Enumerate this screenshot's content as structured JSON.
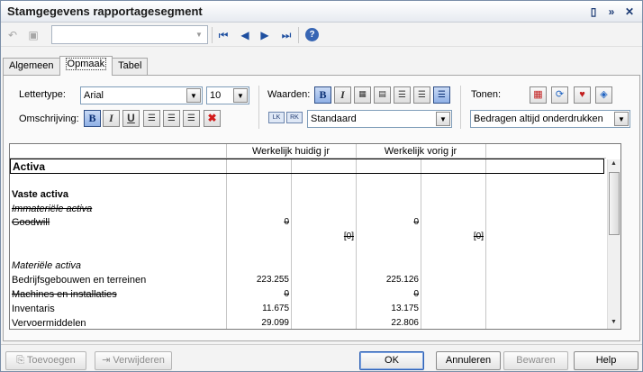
{
  "window": {
    "title": "Stamgegevens rapportagesegment"
  },
  "titlebar_icons": [
    "dock-icon",
    "collapse-icon",
    "close-icon"
  ],
  "toolbar": {
    "combo_value": ""
  },
  "tabs": [
    {
      "label": "Algemeen",
      "active": false
    },
    {
      "label": "Opmaak",
      "active": true
    },
    {
      "label": "Tabel",
      "active": false
    }
  ],
  "format": {
    "lettertype_label": "Lettertype:",
    "font_value": "Arial",
    "size_value": "10",
    "omschrijving_label": "Omschrijving:",
    "waarden_label": "Waarden:",
    "waarden_select": "Standaard",
    "lk_label": "LK",
    "rk_label": "RK",
    "tonen_label": "Tonen:",
    "tonen_select": "Bedragen altijd onderdrukken"
  },
  "grid": {
    "columns": [
      "Werkelijk huidig jr",
      "Werkelijk vorig jr"
    ],
    "section_title": "Activa",
    "rows": [
      {
        "label": "Vaste activa",
        "style": "bold",
        "c1": "",
        "c2": "",
        "c3": "",
        "c4": ""
      },
      {
        "label": "Immateriële activa",
        "style": "italic-strike",
        "c1": "",
        "c2": "",
        "c3": "",
        "c4": ""
      },
      {
        "label": "Goodwill",
        "style": "strike",
        "c1": "0",
        "c2": "",
        "c3": "0",
        "c4": ""
      },
      {
        "label": "",
        "style": "",
        "c1": "",
        "c2": "[0]",
        "c3": "",
        "c4": "[0]"
      },
      {
        "label": "Materiële activa",
        "style": "italic",
        "c1": "",
        "c2": "",
        "c3": "",
        "c4": ""
      },
      {
        "label": "Bedrijfsgebouwen en terreinen",
        "style": "",
        "c1": "223.255",
        "c2": "",
        "c3": "225.126",
        "c4": ""
      },
      {
        "label": "Machines en installaties",
        "style": "strike",
        "c1": "0",
        "c2": "",
        "c3": "0",
        "c4": ""
      },
      {
        "label": "Inventaris",
        "style": "",
        "c1": "11.675",
        "c2": "",
        "c3": "13.175",
        "c4": ""
      },
      {
        "label": "Vervoermiddelen",
        "style": "",
        "c1": "29.099",
        "c2": "",
        "c3": "22.806",
        "c4": ""
      }
    ]
  },
  "buttons": {
    "toevoegen": "Toevoegen",
    "verwijderen": "Verwijderen",
    "ok": "OK",
    "annuleren": "Annuleren",
    "bewaren": "Bewaren",
    "help": "Help"
  }
}
